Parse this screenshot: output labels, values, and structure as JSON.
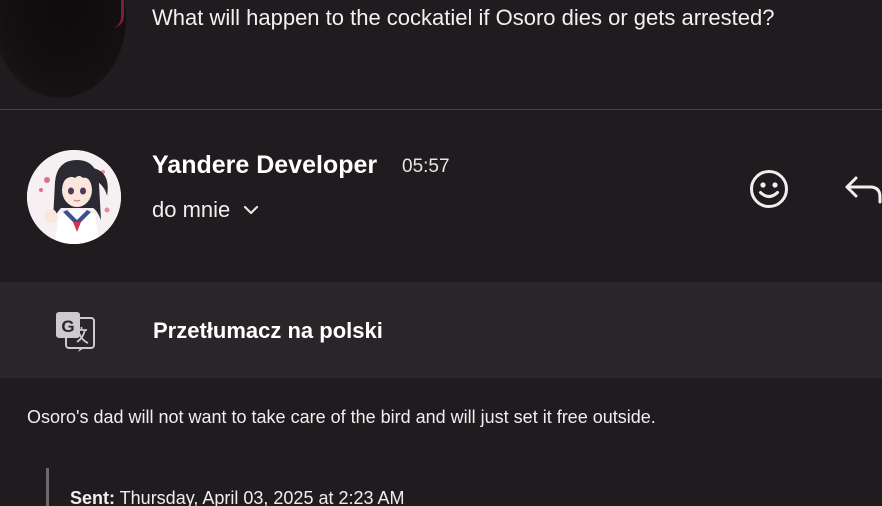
{
  "previous_message": {
    "text": "What will happen to the cockatiel if Osoro dies or gets arrested?"
  },
  "message": {
    "sender": "Yandere Developer",
    "time": "05:57",
    "recipient": "do mnie",
    "icons": {
      "expand": "chevron-down-icon",
      "react": "emoji-smile-icon",
      "reply": "reply-arrow-icon",
      "translate": "google-translate-icon"
    }
  },
  "translate": {
    "label": "Przetłumacz na polski"
  },
  "body": {
    "text": "Osoro's dad will not want to take care of the bird and will just set it free outside.",
    "quoted_sent_label": "Sent:",
    "quoted_sent_value": " Thursday, April 03, 2025 at 2:23 AM"
  },
  "colors": {
    "background": "#1f1b1e",
    "translate_bar": "#2a2529",
    "divider": "#4a4548",
    "text": "#ffffff"
  }
}
